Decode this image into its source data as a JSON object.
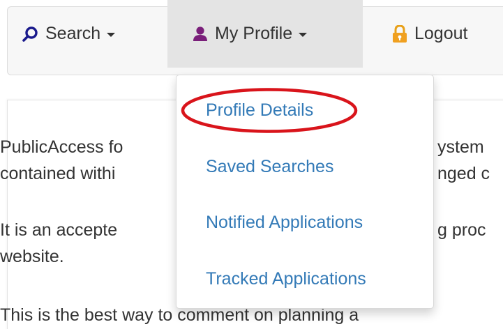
{
  "navbar": {
    "search_label": "Search",
    "search_icon": "search-icon",
    "profile_label": "My Profile",
    "profile_icon": "user-icon",
    "logout_label": "Logout",
    "logout_icon": "lock-icon",
    "icon_color_search": "#1a1a8c",
    "icon_color_profile": "#7a1f7a",
    "icon_color_logout": "#f0a020"
  },
  "body_text": {
    "line1": "PublicAccess fo",
    "line1_right": "ystem",
    "line2": "contained withi",
    "line2_right": "nged c",
    "line3": "It is an accepte",
    "line3_right": "g proc",
    "line4": "website.",
    "line5": "This is the best way to comment on planning a"
  },
  "profile_menu": {
    "items": [
      {
        "label": "Profile Details"
      },
      {
        "label": "Saved Searches"
      },
      {
        "label": "Notified Applications"
      },
      {
        "label": "Tracked Applications"
      }
    ],
    "link_color": "#337ab7",
    "highlight_color": "#d9141b"
  }
}
